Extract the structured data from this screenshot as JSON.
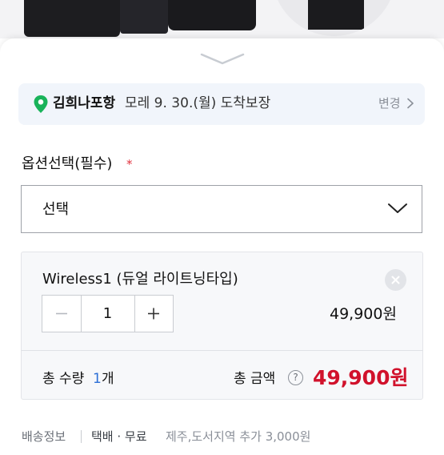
{
  "delivery": {
    "location": "김희나포항",
    "date": "모레 9. 30.(월) 도착보장",
    "change_label": "변경"
  },
  "option": {
    "label": "옵션선택(필수)",
    "required_mark": "*",
    "selected": "선택"
  },
  "cart_item": {
    "name": "Wireless1 (듀얼 라이트닝타입)",
    "quantity": "1",
    "price": "49,900원"
  },
  "totals": {
    "qty_label": "총 수량",
    "qty_value": "1",
    "qty_unit": "개",
    "amount_label": "총 금액",
    "help_glyph": "?",
    "amount_value": "49,900원"
  },
  "shipping": {
    "label": "배송정보",
    "type": "택배 · 무료",
    "extra": "제주,도서지역 추가 3,000원"
  },
  "colors": {
    "accent_red": "#d1122c",
    "qty_blue": "#2c6fd6",
    "pin_green": "#19b35a"
  },
  "icons": [
    "chevron-down-icon",
    "location-pin-icon",
    "chevron-right-icon",
    "close-icon",
    "minus-icon",
    "plus-icon",
    "help-icon"
  ]
}
